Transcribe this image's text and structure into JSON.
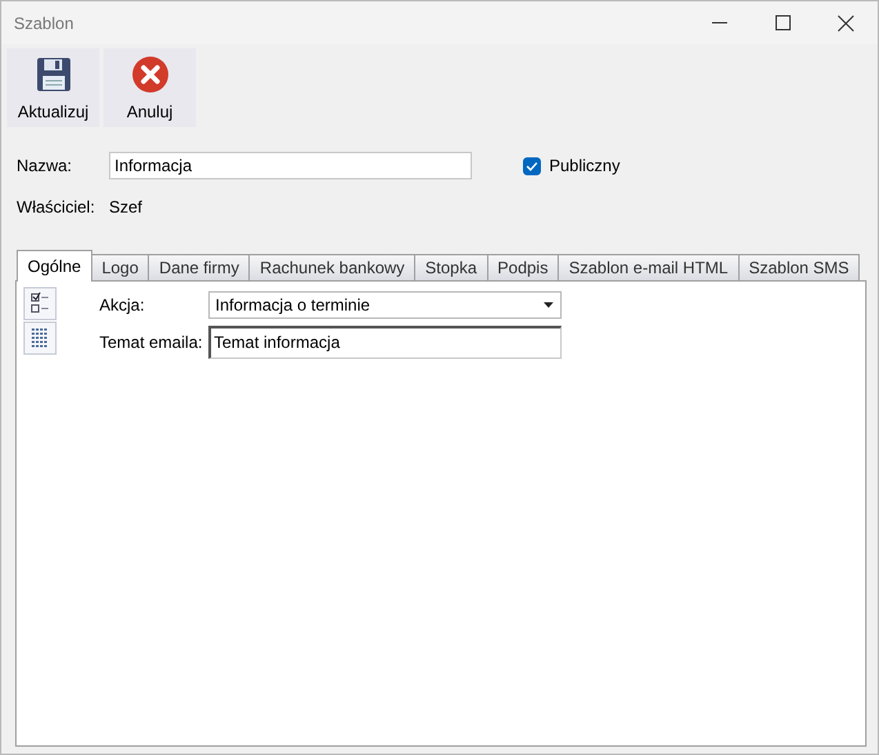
{
  "window": {
    "title": "Szablon"
  },
  "toolbar": [
    {
      "kind": "save",
      "label": "Aktualizuj"
    },
    {
      "kind": "cancel",
      "label": "Anuluj"
    }
  ],
  "name": {
    "label": "Nazwa:",
    "value": "Informacja"
  },
  "public": {
    "label": "Publiczny",
    "checked": true
  },
  "owner": {
    "label": "Właściciel:",
    "value": "Szef"
  },
  "tabs": [
    {
      "label": "Ogólne",
      "selected": true
    },
    {
      "label": "Logo",
      "selected": false
    },
    {
      "label": "Dane firmy",
      "selected": false
    },
    {
      "label": "Rachunek bankowy",
      "selected": false
    },
    {
      "label": "Stopka",
      "selected": false
    },
    {
      "label": "Podpis",
      "selected": false
    },
    {
      "label": "Szablon e-mail HTML",
      "selected": false
    },
    {
      "label": "Szablon SMS",
      "selected": false
    }
  ],
  "side_buttons": [
    {
      "kind": "checklist"
    },
    {
      "kind": "grid"
    }
  ],
  "fields": [
    {
      "kind": "dropdown",
      "label": "Akcja:",
      "value": "Informacja o terminie"
    },
    {
      "kind": "text",
      "label": "Temat emaila:",
      "value": "Temat informacja"
    }
  ]
}
